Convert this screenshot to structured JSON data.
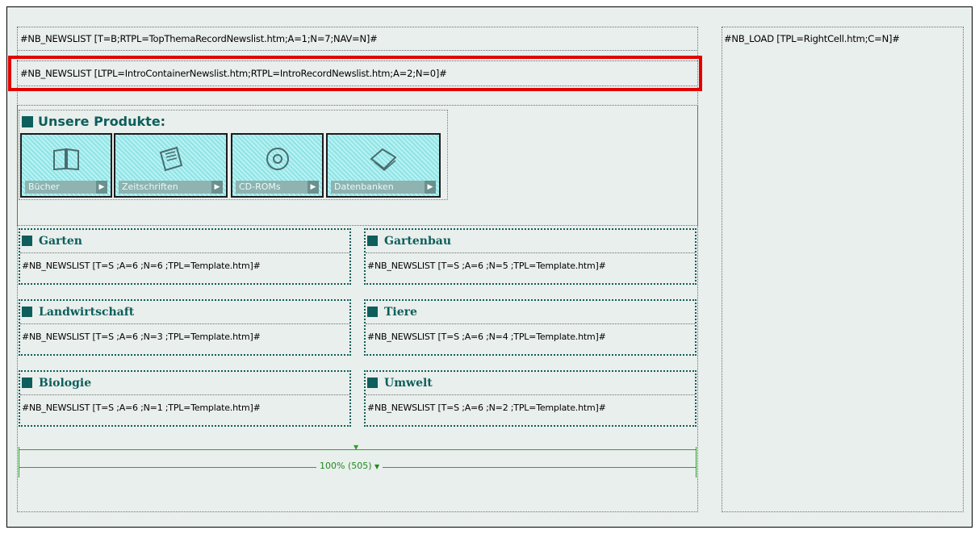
{
  "top_row": {
    "main_code": "#NB_NEWSLIST [T=B;RTPL=TopThemaRecordNewslist.htm;A=1;N=7;NAV=N]#",
    "right_code": "#NB_LOAD [TPL=RightCell.htm;C=N]#"
  },
  "intro_row": {
    "code": "#NB_NEWSLIST [LTPL=IntroContainerNewslist.htm;RTPL=IntroRecordNewslist.htm;A=2;N=0]#"
  },
  "products": {
    "title": "Unsere Produkte:",
    "tiles": [
      {
        "label": "Bücher",
        "icon": "book-icon"
      },
      {
        "label": "Zeitschriften",
        "icon": "magazine-icon"
      },
      {
        "label": "CD-ROMs",
        "icon": "cd-icon"
      },
      {
        "label": "Datenbanken",
        "icon": "database-icon"
      }
    ]
  },
  "sections": [
    {
      "title": "Garten",
      "code": "#NB_NEWSLIST [T=S ;A=6 ;N=6 ;TPL=Template.htm]#"
    },
    {
      "title": "Gartenbau",
      "code": "#NB_NEWSLIST [T=S ;A=6 ;N=5 ;TPL=Template.htm]#"
    },
    {
      "title": "Landwirtschaft",
      "code": "#NB_NEWSLIST [T=S ;A=6 ;N=3 ;TPL=Template.htm]#"
    },
    {
      "title": "Tiere",
      "code": "#NB_NEWSLIST [T=S ;A=6 ;N=4 ;TPL=Template.htm]#"
    },
    {
      "title": "Biologie",
      "code": "#NB_NEWSLIST [T=S ;A=6 ;N=1 ;TPL=Template.htm]#"
    },
    {
      "title": "Umwelt",
      "code": "#NB_NEWSLIST [T=S ;A=6 ;N=2 ;TPL=Template.htm]#"
    }
  ],
  "width_indicator": {
    "label": "100% (505)",
    "dropdown_icon": "triangle-down-icon"
  },
  "colors": {
    "highlight": "#e00000",
    "accent": "#0d5e5c",
    "ruler": "#2ea02e"
  }
}
